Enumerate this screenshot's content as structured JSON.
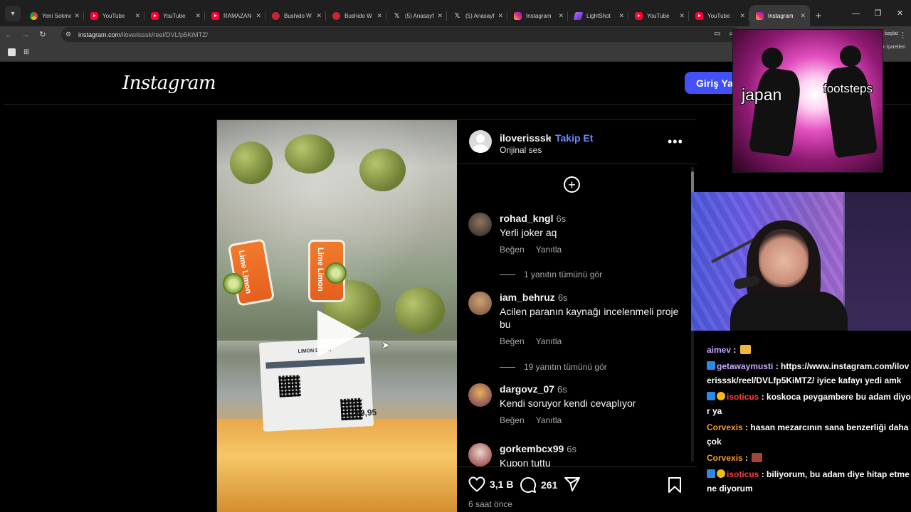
{
  "browser": {
    "tabs": [
      {
        "favicon": "chrome-icon",
        "title": "Yeni Sekme"
      },
      {
        "favicon": "youtube-icon",
        "title": "YouTube"
      },
      {
        "favicon": "youtube-icon",
        "title": "YouTube"
      },
      {
        "favicon": "youtube-icon",
        "title": "RAMAZAN"
      },
      {
        "favicon": "bushido-icon",
        "title": "Bushido W"
      },
      {
        "favicon": "bushido-icon",
        "title": "Bushido W"
      },
      {
        "favicon": "x-icon",
        "title": "(5) Anasayf"
      },
      {
        "favicon": "x-icon",
        "title": "(5) Anasayf"
      },
      {
        "favicon": "instagram-icon",
        "title": "Instagram"
      },
      {
        "favicon": "lightshot-icon",
        "title": "LightShot"
      },
      {
        "favicon": "youtube-icon",
        "title": "YouTube"
      },
      {
        "favicon": "youtube-icon",
        "title": "YouTube"
      },
      {
        "favicon": "instagram-icon",
        "title": "Instagram",
        "active": true
      }
    ],
    "url_host": "instagram.com",
    "url_path": "/iloverisssk/reel/DVLfp5KiMTZ/",
    "peek_text_1": "başlat",
    "peek_text_2": "r İşaretleri"
  },
  "header": {
    "logo": "Instagram",
    "login_label": "Giriş Yap"
  },
  "post": {
    "owner": "iloverisssk",
    "separator": "•",
    "follow_label": "Takip Et",
    "audio": "Orijinal ses",
    "video": {
      "tag_title": "LIMON DIGER",
      "price": "79,95",
      "label_text": "Lime Limon"
    },
    "comments": [
      {
        "user": "rohad_kngl",
        "time": "6s",
        "text": "Yerli joker aq",
        "like_label": "Beğen",
        "reply_label": "Yanıtla",
        "replies": "1 yanıtın tümünü gör"
      },
      {
        "user": "iam_behruz",
        "time": "6s",
        "text": "Acilen paranın kaynağı incelenmeli proje bu",
        "like_label": "Beğen",
        "reply_label": "Yanıtla",
        "replies": "19 yanıtın tümünü gör"
      },
      {
        "user": "dargovz_07",
        "time": "6s",
        "text": "Kendi soruyor kendi cevaplıyor",
        "like_label": "Beğen",
        "reply_label": "Yanıtla"
      },
      {
        "user": "gorkembcx99",
        "time": "6s",
        "text": "Kupon tuttu"
      }
    ],
    "likes": "3,1 B",
    "comment_count": "261",
    "posted": "6 saat önce"
  },
  "meme": {
    "left_text": "japan",
    "right_text": "footsteps"
  },
  "chat": {
    "messages": [
      {
        "badges": [],
        "user": "aimev",
        "user_color": "#c9a8ff",
        "text": "",
        "emote": "#f1b53b"
      },
      {
        "badges": [
          "prime"
        ],
        "user": "getawaymusti",
        "user_color": "#c9a8ff",
        "text": "https://www.instagram.com/iloverisssk/reel/DVLfp5KiMTZ/ iyice kafayı yedi amk"
      },
      {
        "badges": [
          "prime",
          "sub"
        ],
        "user": "isoticus",
        "user_color": "#ff3b3b",
        "text": "koskoca peygambere bu adam diyor ya"
      },
      {
        "badges": [],
        "user": "Corvexis",
        "user_color": "#ff9f1a",
        "text": "hasan mezarcının sana benzerliği daha çok"
      },
      {
        "badges": [],
        "user": "Corvexis",
        "user_color": "#ff9f1a",
        "text": "",
        "emote": "#a0453a"
      },
      {
        "badges": [
          "prime",
          "sub"
        ],
        "user": "isoticus",
        "user_color": "#ff3b3b",
        "text": "biliyorum, bu adam diye hitap etmene diyorum"
      }
    ]
  }
}
